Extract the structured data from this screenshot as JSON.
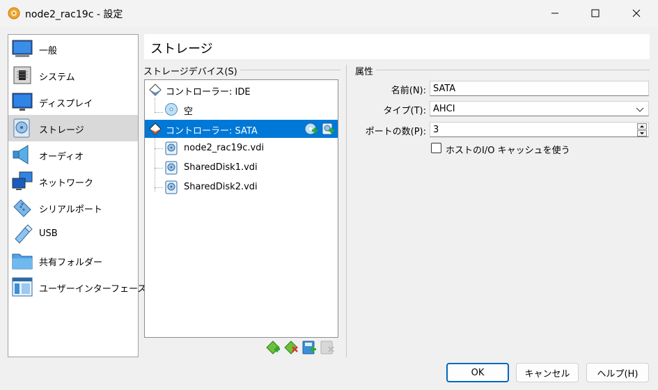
{
  "window": {
    "title": "node2_rac19c - 設定"
  },
  "sidebar": {
    "items": [
      {
        "label": "一般",
        "icon": "general-icon"
      },
      {
        "label": "システム",
        "icon": "system-icon"
      },
      {
        "label": "ディスプレイ",
        "icon": "display-icon"
      },
      {
        "label": "ストレージ",
        "icon": "storage-icon",
        "selected": true
      },
      {
        "label": "オーディオ",
        "icon": "audio-icon"
      },
      {
        "label": "ネットワーク",
        "icon": "network-icon"
      },
      {
        "label": "シリアルポート",
        "icon": "serial-port-icon"
      },
      {
        "label": "USB",
        "icon": "usb-icon"
      },
      {
        "label": "共有フォルダー",
        "icon": "shared-folder-icon"
      },
      {
        "label": "ユーザーインターフェース",
        "icon": "user-interface-icon"
      }
    ]
  },
  "page": {
    "title": "ストレージ"
  },
  "storage_devices": {
    "label": "ストレージデバイス(S)",
    "tree": [
      {
        "label": "コントローラー: IDE",
        "icon": "controller-ide-icon"
      },
      {
        "label": "空",
        "icon": "optical-disc-icon"
      },
      {
        "label": "コントローラー: SATA",
        "icon": "controller-sata-icon",
        "selected": true
      },
      {
        "label": "node2_rac19c.vdi",
        "icon": "hard-disk-icon"
      },
      {
        "label": "SharedDisk1.vdi",
        "icon": "hard-disk-icon"
      },
      {
        "label": "SharedDisk2.vdi",
        "icon": "hard-disk-icon"
      }
    ],
    "row_actions": [
      "add-optical-drive-icon",
      "add-hard-disk-icon"
    ],
    "toolbar": [
      "add-controller-icon",
      "remove-controller-icon",
      "add-attachment-icon",
      "remove-attachment-icon"
    ]
  },
  "attributes": {
    "label": "属性",
    "name_label": "名前(N):",
    "name_value": "SATA",
    "type_label": "タイプ(T):",
    "type_value": "AHCI",
    "ports_label": "ポートの数(P):",
    "ports_value": "3",
    "host_io_cache_label": "ホストのI/O キャッシュを使う",
    "host_io_cache_checked": false
  },
  "buttons": {
    "ok": "OK",
    "cancel": "キャンセル",
    "help": "ヘルプ(H)"
  },
  "colors": {
    "selection": "#0078d7",
    "sidebar_selected": "#d9d9d9",
    "default_button_border": "#0067c0"
  }
}
